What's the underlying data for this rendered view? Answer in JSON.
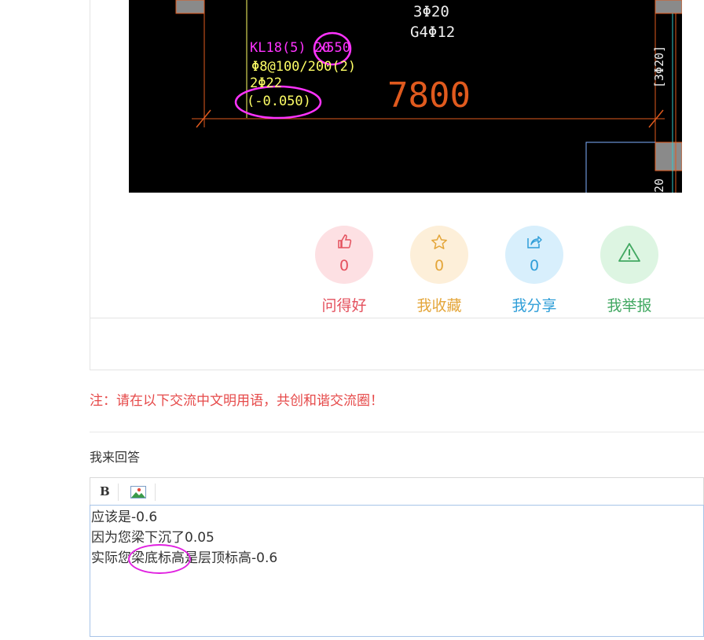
{
  "cad": {
    "rebar_top": "3Φ20",
    "rebar_mid": "G4Φ12",
    "beam_id": "KL18(5) 20",
    "beam_size": "x550",
    "stirrup": "Φ8@100/200(2)",
    "bottom_bar": "2Φ22",
    "elevation": "(-0.050)",
    "span": "7800",
    "side_label": "[3Φ20]",
    "side_label_2": "20",
    "colors": {
      "background": "#000000",
      "magenta": "#ff33ff",
      "yellow": "#ffff66",
      "dim_orange": "#e05a1e",
      "column_gray": "#8a8a8a",
      "cyan": "#33cccc"
    }
  },
  "actions": [
    {
      "label": "问得好",
      "count": "0",
      "icon": "thumbs-up-icon",
      "color": "#e4505d",
      "bg": "#fde0e3"
    },
    {
      "label": "我收藏",
      "count": "0",
      "icon": "star-icon",
      "color": "#e4a63a",
      "bg": "#fdefd9"
    },
    {
      "label": "我分享",
      "count": "0",
      "icon": "share-icon",
      "color": "#2f9ed8",
      "bg": "#d8effc"
    },
    {
      "label": "我举报",
      "count": "",
      "icon": "warning-icon",
      "color": "#42a862",
      "bg": "#ddf5e2"
    }
  ],
  "notice": "注：请在以下交流中文明用语，共创和谐交流圈！",
  "answer_title": "我来回答",
  "toolbar": {
    "bold_label": "B",
    "image_icon": "image-icon"
  },
  "editor": {
    "lines": [
      "应该是-0.6",
      "因为您梁下沉了0.05",
      "实际您梁底标高是层顶标高-0.6"
    ]
  }
}
